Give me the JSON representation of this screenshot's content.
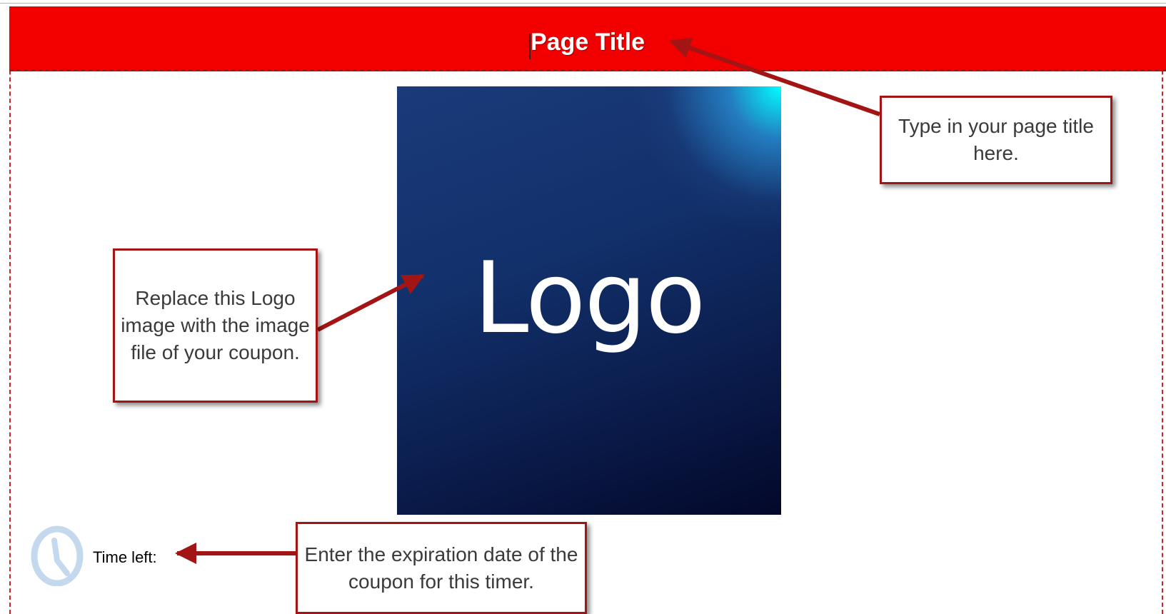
{
  "header": {
    "title": "Page Title",
    "background_color": "#f20000"
  },
  "logo": {
    "text": "Logo"
  },
  "timer": {
    "label": "Time left:",
    "icon": "clock-icon"
  },
  "callouts": {
    "title_hint": "Type in your page title here.",
    "logo_hint": "Replace this Logo image with the image file of your coupon.",
    "timer_hint": "Enter the expiration date of the coupon for this timer."
  },
  "colors": {
    "accent": "#a31515",
    "callout_border": "#a31515"
  }
}
